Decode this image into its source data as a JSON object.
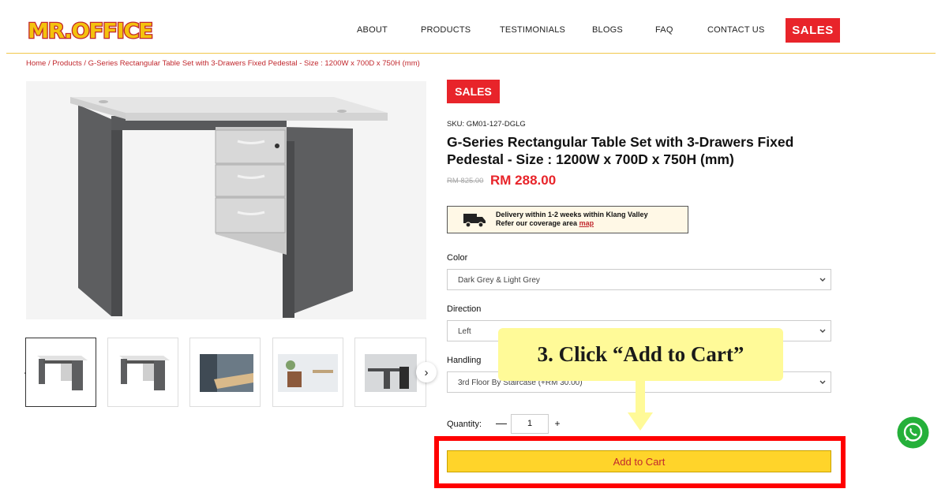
{
  "header": {
    "logo_text": "MR.OFFICE",
    "nav": [
      "ABOUT",
      "PRODUCTS",
      "TESTIMONIALS",
      "BLOGS",
      "FAQ",
      "CONTACT US"
    ],
    "sales_label": "SALES"
  },
  "breadcrumb": "Home / Products / G-Series Rectangular Table Set with 3-Drawers Fixed Pedestal - Size : 1200W x 700D x 750H (mm)",
  "product": {
    "sales_tag": "SALES",
    "sku": "SKU: GM01-127-DGLG",
    "title": "G-Series Rectangular Table Set with 3-Drawers Fixed Pedestal - Size : 1200W x 700D x 750H (mm)",
    "old_price": "RM 825.00",
    "price": "RM 288.00",
    "delivery_line1": "Delivery within 1-2 weeks within Klang Valley",
    "delivery_line2": "Refer our coverage area",
    "delivery_link": "map"
  },
  "options": {
    "color_label": "Color",
    "color_value": "Dark Grey & Light Grey",
    "direction_label": "Direction",
    "direction_value": "Left",
    "handling_label": "Handling",
    "handling_value": "3rd Floor By Staircase (+RM 30.00)"
  },
  "quantity": {
    "label": "Quantity:",
    "minus": "—",
    "value": "1",
    "plus": "+"
  },
  "add_to_cart": "Add to Cart",
  "annotation": {
    "callout": "3. Click “Add to Cart”"
  },
  "colors": {
    "brand_red": "#e8242a",
    "brand_yellow": "#ffd42a",
    "callout_yellow": "#fffa98",
    "highlight_red": "#ff0000",
    "whatsapp_green": "#25b03a"
  }
}
